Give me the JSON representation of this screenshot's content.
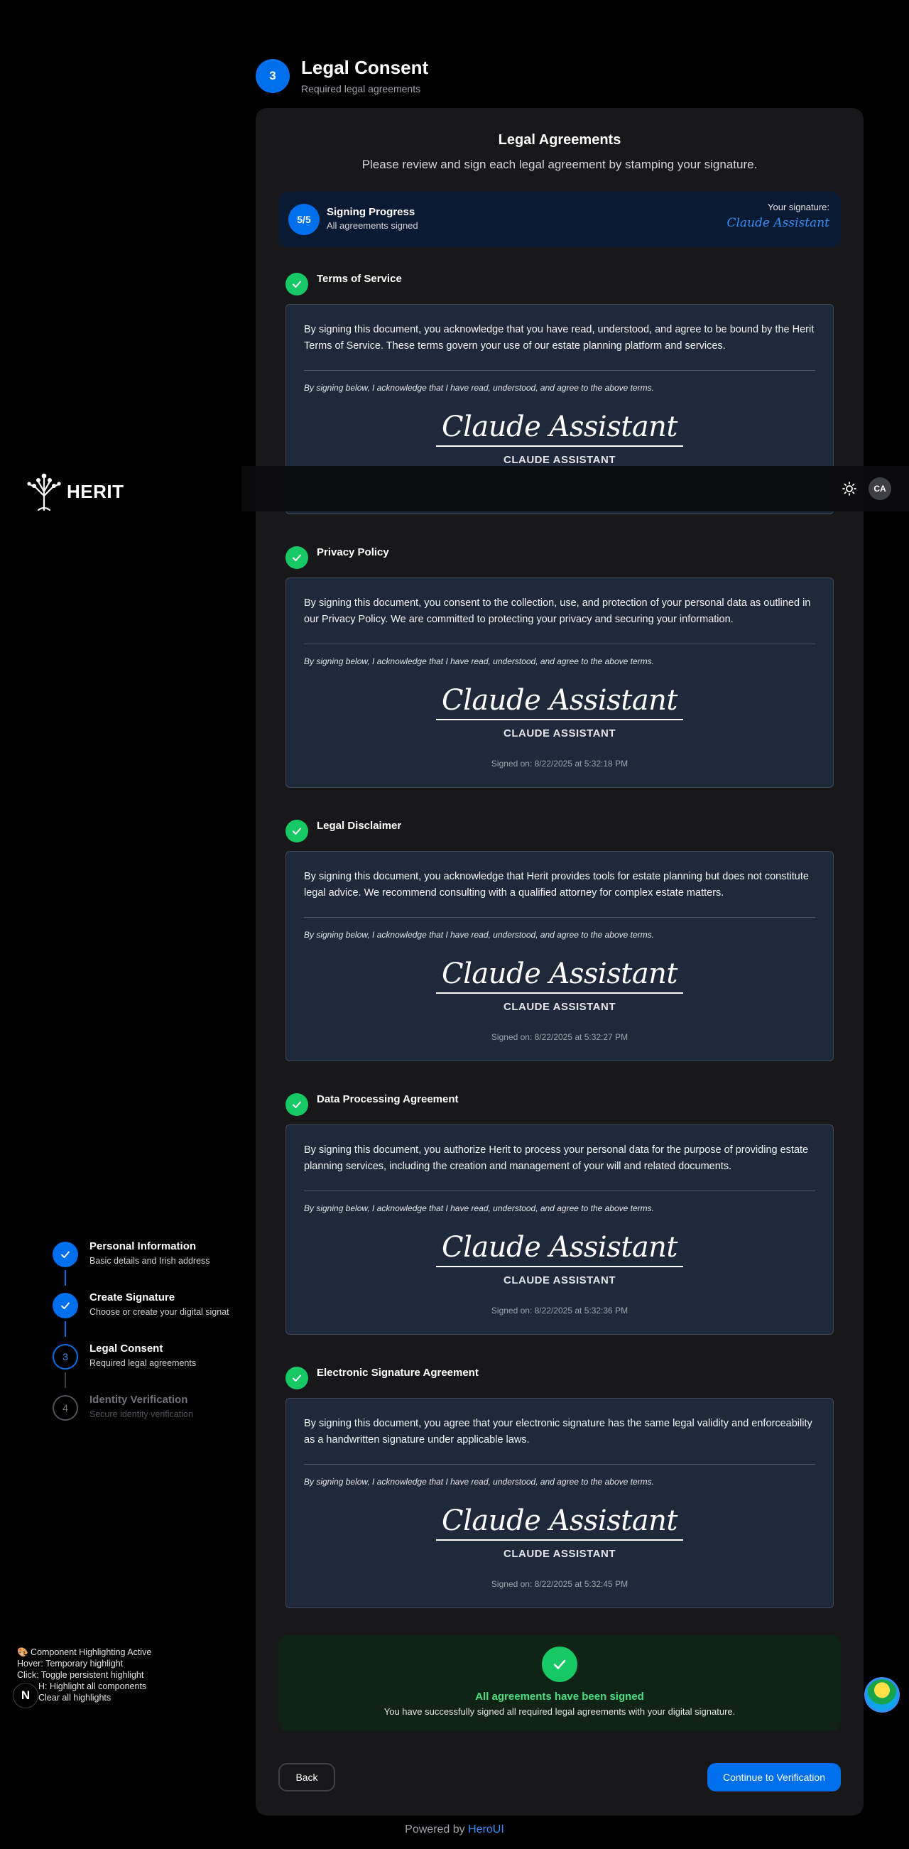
{
  "step": {
    "number": "3",
    "title": "Legal Consent",
    "subtitle": "Required legal agreements"
  },
  "card": {
    "title": "Legal Agreements",
    "description": "Please review and sign each legal agreement by stamping your signature."
  },
  "progress": {
    "count": "5/5",
    "title": "Signing Progress",
    "subtitle": "All agreements signed",
    "signature_label": "Your signature:",
    "signature_value": "Claude Assistant"
  },
  "acknowledgement": "By signing below, I acknowledge that I have read, understood, and agree to the above terms.",
  "signature_script": "Claude Assistant",
  "signature_name": "CLAUDE ASSISTANT",
  "agreements": [
    {
      "title": "Terms of Service",
      "text": "By signing this document, you acknowledge that you have read, understood, and agree to be bound by the Herit Terms of Service. These terms govern your use of our estate planning platform and services.",
      "signed_on": ""
    },
    {
      "title": "Privacy Policy",
      "text": "By signing this document, you consent to the collection, use, and protection of your personal data as outlined in our Privacy Policy. We are committed to protecting your privacy and securing your information.",
      "signed_on": "Signed on: 8/22/2025 at 5:32:18 PM"
    },
    {
      "title": "Legal Disclaimer",
      "text": "By signing this document, you acknowledge that Herit provides tools for estate planning but does not constitute legal advice. We recommend consulting with a qualified attorney for complex estate matters.",
      "signed_on": "Signed on: 8/22/2025 at 5:32:27 PM"
    },
    {
      "title": "Data Processing Agreement",
      "text": "By signing this document, you authorize Herit to process your personal data for the purpose of providing estate planning services, including the creation and management of your will and related documents.",
      "signed_on": "Signed on: 8/22/2025 at 5:32:36 PM"
    },
    {
      "title": "Electronic Signature Agreement",
      "text": "By signing this document, you agree that your electronic signature has the same legal validity and enforceability as a handwritten signature under applicable laws.",
      "signed_on": "Signed on: 8/22/2025 at 5:32:45 PM"
    }
  ],
  "completion": {
    "title": "All agreements have been signed",
    "subtitle": "You have successfully signed all required legal agreements with your digital signature."
  },
  "buttons": {
    "back": "Back",
    "continue": "Continue to Verification"
  },
  "footer": {
    "prefix": "Powered by",
    "link": "HeroUI"
  },
  "topbar": {
    "logo_text": "HERIT",
    "avatar": "CA"
  },
  "stepper": [
    {
      "number": "1",
      "label": "Personal Information",
      "desc": "Basic details and Irish address",
      "state": "done"
    },
    {
      "number": "2",
      "label": "Create Signature",
      "desc": "Choose or create your digital signat",
      "state": "done"
    },
    {
      "number": "3",
      "label": "Legal Consent",
      "desc": "Required legal agreements",
      "state": "active"
    },
    {
      "number": "4",
      "label": "Identity Verification",
      "desc": "Secure identity verification",
      "state": "todo"
    }
  ],
  "debug": {
    "line1": "🎨 Component Highlighting Active",
    "line2": "Hover: Temporary highlight",
    "line3": "Click: Toggle persistent highlight",
    "line4": "H: Highlight all components",
    "line5": "Clear all highlights",
    "n_label": "N"
  },
  "colors": {
    "accent": "#006fee",
    "success": "#17c964",
    "card": "#18181b",
    "doc": "#1e293b"
  }
}
